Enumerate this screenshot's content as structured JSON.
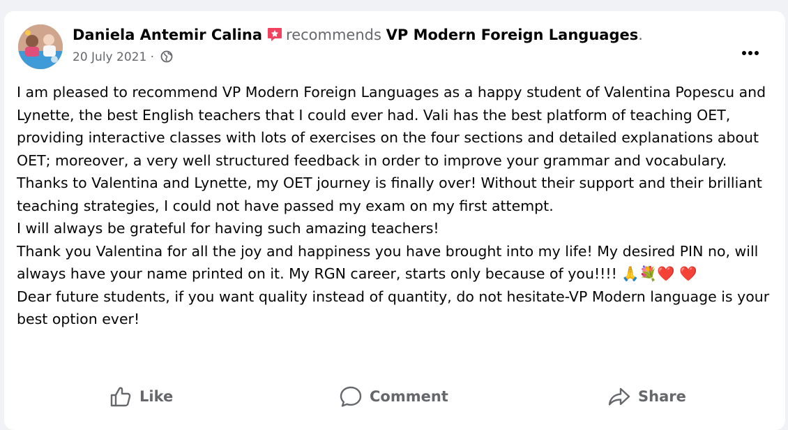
{
  "post": {
    "author": "Daniela Antemir Calina",
    "action_verb": "recommends",
    "page_name": "VP Modern Foreign Languages",
    "trailing_dot": ".",
    "date": "20 July 2021",
    "date_separator": " · ",
    "audience_icon": "globe-icon",
    "recommend_icon": "recommendation-badge-icon",
    "more_icon": "more-options-icon",
    "paragraphs": [
      "I am pleased to recommend VP Modern Foreign Languages as a happy student of Valentina Popescu and Lynette, the best English teachers that I could ever had. Vali has the best platform of teaching OET, providing interactive classes with lots of exercises on the four sections and detailed explanations about OET; moreover, a very well structured feedback in order to improve your grammar and vocabulary. Thanks  to Valentina and Lynette, my OET journey is finally over! Without their support and their brilliant teaching strategies, I could not have passed my exam on my  first attempt.",
      "I will always be grateful for having such amazing teachers!",
      "Thank you Valentina for all the joy and happiness you have brought into my life! My desired PIN no, will always have your name printed on it. My RGN career, starts only because of you!!!! 🙏💐❤️ ❤️",
      "Dear future students, if you want quality instead of quantity, do not hesitate-VP Modern language is your best option ever!"
    ]
  },
  "actions": {
    "like": "Like",
    "comment": "Comment",
    "share": "Share"
  },
  "colors": {
    "page_bg": "#f0f2f5",
    "card_bg": "#ffffff",
    "primary_text": "#050505",
    "secondary_text": "#65676b",
    "recommend_badge": "#f3425f"
  }
}
